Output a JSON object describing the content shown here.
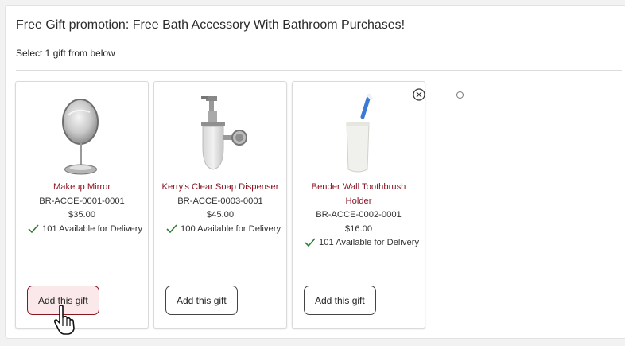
{
  "promotion": {
    "title": "Free Gift promotion: Free Bath Accessory With Bathroom Purchases!",
    "subtitle": "Select 1 gift from below"
  },
  "gifts": [
    {
      "name": "Makeup Mirror",
      "sku": "BR-ACCE-0001-0001",
      "price": "$35.00",
      "availability": "101 Available for Delivery",
      "button_label": "Add this gift",
      "image_icon": "makeup-mirror-image"
    },
    {
      "name": "Kerry's Clear Soap Dispenser",
      "sku": "BR-ACCE-0003-0001",
      "price": "$45.00",
      "availability": "100 Available for Delivery",
      "button_label": "Add this gift",
      "image_icon": "soap-dispenser-image"
    },
    {
      "name": "Bender Wall Toothbrush Holder",
      "sku": "BR-ACCE-0002-0001",
      "price": "$16.00",
      "availability": "101 Available for Delivery",
      "button_label": "Add this gift",
      "image_icon": "toothbrush-holder-image"
    }
  ],
  "colors": {
    "product_name": "#8a1522",
    "check": "#2e7d32",
    "hover_button_bg": "#fbe8ea"
  },
  "icons": {
    "close": "close-circle-icon",
    "check": "check-icon",
    "cursor": "hand-pointer-cursor"
  }
}
